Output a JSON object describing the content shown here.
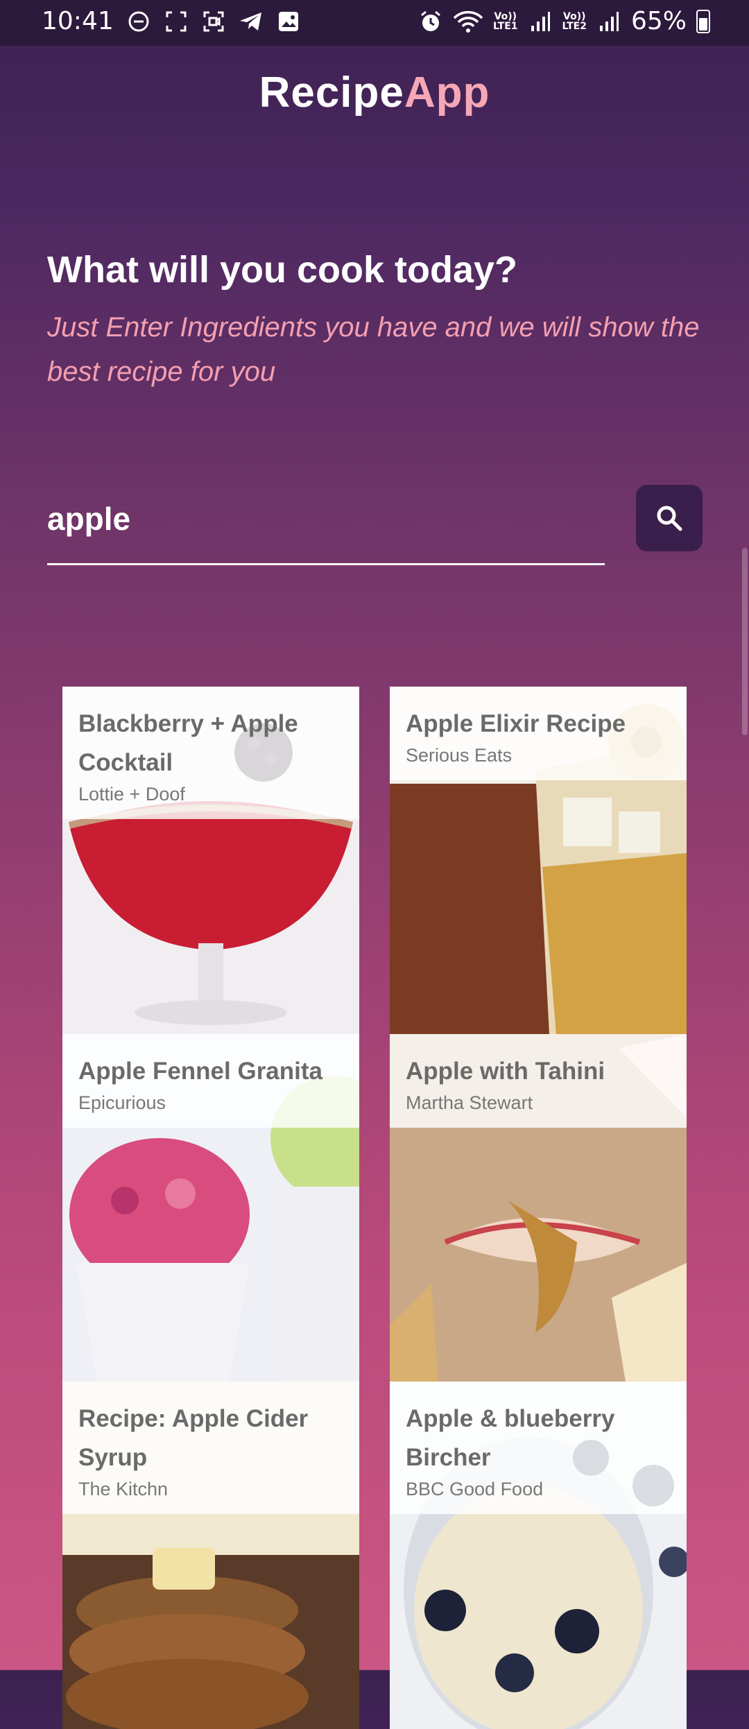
{
  "status_bar": {
    "time": "10:41",
    "battery_percent": "65%",
    "lte1": "LTE1",
    "lte2": "LTE2",
    "volte": "Vo))",
    "icons_left": [
      "dnd-icon",
      "screenshot-icon",
      "screen-record-icon",
      "telegram-icon",
      "gallery-icon"
    ],
    "icons_right": [
      "alarm-icon",
      "wifi-icon",
      "signal-icon",
      "battery-icon"
    ]
  },
  "app": {
    "title_part1": "Recipe",
    "title_part2": "App",
    "accent_color": "#f6a7b6"
  },
  "hero": {
    "heading": "What will you cook today?",
    "subheading": "Just Enter Ingredients you have and we will show the best recipe for you"
  },
  "search": {
    "value": "apple",
    "button_icon": "search-icon"
  },
  "recipes": [
    {
      "title": "Blackberry + Apple Cocktail",
      "source": "Lottie + Doof"
    },
    {
      "title": "Apple Elixir Recipe",
      "source": "Serious Eats"
    },
    {
      "title": "Apple Fennel Granita",
      "source": "Epicurious"
    },
    {
      "title": "Apple with Tahini",
      "source": "Martha Stewart"
    },
    {
      "title": "Recipe: Apple Cider Syrup",
      "source": "The Kitchn"
    },
    {
      "title": "Apple & blueberry Bircher",
      "source": "BBC Good Food"
    }
  ]
}
